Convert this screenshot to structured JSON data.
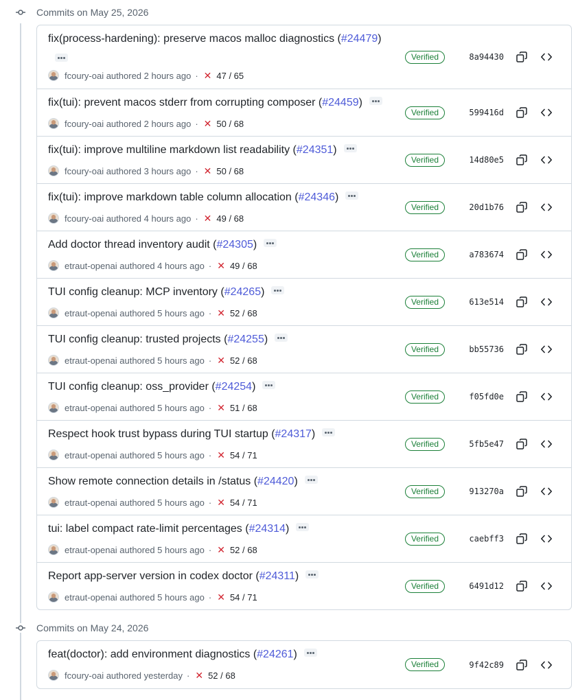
{
  "groups": [
    {
      "title": "Commits on May 25, 2026",
      "commits": [
        {
          "title_prefix": "fix(process-hardening): preserve macos malloc diagnostics (",
          "pr": "#24479",
          "title_suffix": ")",
          "author": "fcoury-oai",
          "authored": "authored 2 hours ago",
          "checks": "47 / 65",
          "verified": "Verified",
          "sha": "8a94430",
          "wrapped": true
        },
        {
          "title_prefix": "fix(tui): prevent macos stderr from corrupting composer (",
          "pr": "#24459",
          "title_suffix": ")",
          "author": "fcoury-oai",
          "authored": "authored 2 hours ago",
          "checks": "50 / 68",
          "verified": "Verified",
          "sha": "599416d"
        },
        {
          "title_prefix": "fix(tui): improve multiline markdown list readability (",
          "pr": "#24351",
          "title_suffix": ")",
          "author": "fcoury-oai",
          "authored": "authored 3 hours ago",
          "checks": "50 / 68",
          "verified": "Verified",
          "sha": "14d80e5"
        },
        {
          "title_prefix": "fix(tui): improve markdown table column allocation (",
          "pr": "#24346",
          "title_suffix": ")",
          "author": "fcoury-oai",
          "authored": "authored 4 hours ago",
          "checks": "49 / 68",
          "verified": "Verified",
          "sha": "20d1b76"
        },
        {
          "title_prefix": "Add doctor thread inventory audit (",
          "pr": "#24305",
          "title_suffix": ")",
          "author": "etraut-openai",
          "authored": "authored 4 hours ago",
          "checks": "49 / 68",
          "verified": "Verified",
          "sha": "a783674"
        },
        {
          "title_prefix": "TUI config cleanup: MCP inventory (",
          "pr": "#24265",
          "title_suffix": ")",
          "author": "etraut-openai",
          "authored": "authored 5 hours ago",
          "checks": "52 / 68",
          "verified": "Verified",
          "sha": "613e514"
        },
        {
          "title_prefix": "TUI config cleanup: trusted projects (",
          "pr": "#24255",
          "title_suffix": ")",
          "author": "etraut-openai",
          "authored": "authored 5 hours ago",
          "checks": "52 / 68",
          "verified": "Verified",
          "sha": "bb55736"
        },
        {
          "title_prefix": "TUI config cleanup: oss_provider (",
          "pr": "#24254",
          "title_suffix": ")",
          "author": "etraut-openai",
          "authored": "authored 5 hours ago",
          "checks": "51 / 68",
          "verified": "Verified",
          "sha": "f05fd0e"
        },
        {
          "title_prefix": "Respect hook trust bypass during TUI startup (",
          "pr": "#24317",
          "title_suffix": ")",
          "author": "etraut-openai",
          "authored": "authored 5 hours ago",
          "checks": "54 / 71",
          "verified": "Verified",
          "sha": "5fb5e47"
        },
        {
          "title_prefix": "Show remote connection details in /status (",
          "pr": "#24420",
          "title_suffix": ")",
          "author": "etraut-openai",
          "authored": "authored 5 hours ago",
          "checks": "54 / 71",
          "verified": "Verified",
          "sha": "913270a"
        },
        {
          "title_prefix": "tui: label compact rate-limit percentages (",
          "pr": "#24314",
          "title_suffix": ")",
          "author": "etraut-openai",
          "authored": "authored 5 hours ago",
          "checks": "52 / 68",
          "verified": "Verified",
          "sha": "caebff3"
        },
        {
          "title_prefix": "Report app-server version in codex doctor (",
          "pr": "#24311",
          "title_suffix": ")",
          "author": "etraut-openai",
          "authored": "authored 5 hours ago",
          "checks": "54 / 71",
          "verified": "Verified",
          "sha": "6491d12"
        }
      ]
    },
    {
      "title": "Commits on May 24, 2026",
      "commits": [
        {
          "title_prefix": "feat(doctor): add environment diagnostics (",
          "pr": "#24261",
          "title_suffix": ")",
          "author": "fcoury-oai",
          "authored": "authored yesterday",
          "checks": "52 / 68",
          "verified": "Verified",
          "sha": "9f42c89"
        }
      ]
    }
  ],
  "separator": "·",
  "icons": {
    "node": "git-commit-icon",
    "copy": "copy-icon",
    "browse": "code-icon",
    "status": "x-icon",
    "more": "ellipsis-icon"
  },
  "colors": {
    "link": "#4e5bd8",
    "verified": "#1a7f37",
    "failure": "#d1242f",
    "border": "#d1d9e0",
    "muted": "#59636e"
  }
}
